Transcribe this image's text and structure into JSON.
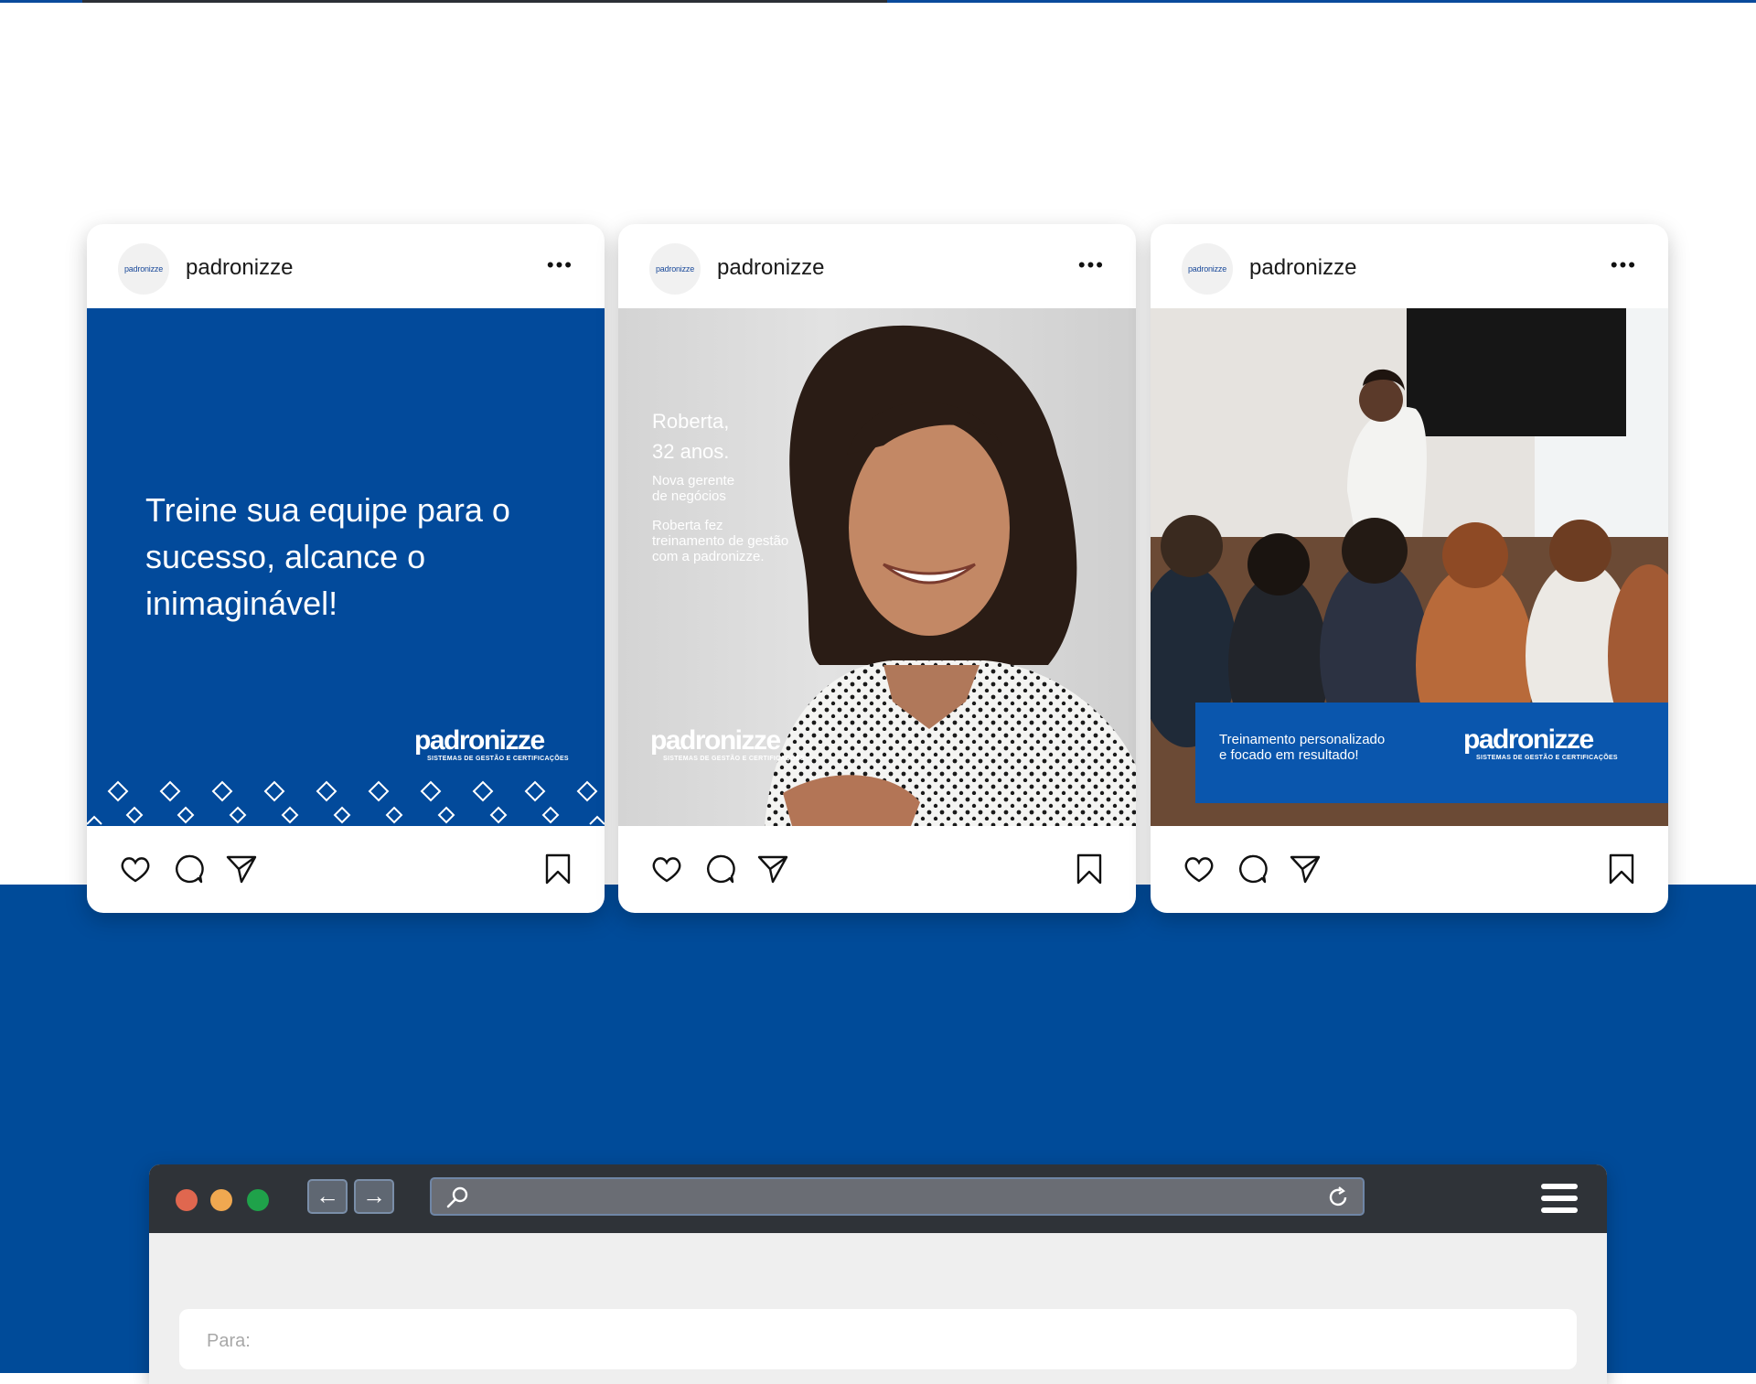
{
  "posts": [
    {
      "username": "padronizze",
      "avatar_text": "padronizze",
      "media": {
        "headline": "Treine sua equipe para o sucesso, alcance o inimaginável!",
        "brand": "padronizze",
        "brand_tagline": "SISTEMAS DE GESTÃO E CERTIFICAÇÕES"
      }
    },
    {
      "username": "padronizze",
      "avatar_text": "padronizze",
      "media": {
        "name_line1": "Roberta,",
        "name_line2": "32 anos.",
        "role": "Nova gerente de negócios",
        "desc": "Roberta fez treinamento de gestão com a padronizze.",
        "brand": "padronizze",
        "brand_tagline": "SISTEMAS DE GESTÃO E CERTIFICAÇÕES"
      }
    },
    {
      "username": "padronizze",
      "avatar_text": "padronizze",
      "media": {
        "banner_line1": "Treinamento personalizado",
        "banner_line2": "e focado em resultado!",
        "brand": "padronizze",
        "brand_tagline": "SISTEMAS DE GESTÃO E CERTIFICAÇÕES"
      }
    }
  ],
  "post_actions": [
    "heart-icon",
    "comment-icon",
    "share-icon",
    "bookmark-icon"
  ],
  "browser": {
    "to_placeholder": "Para:"
  },
  "colors": {
    "brand_blue": "#004b99",
    "window_red": "#e0674f",
    "window_yellow": "#f0a850",
    "window_green": "#1fa24a"
  }
}
